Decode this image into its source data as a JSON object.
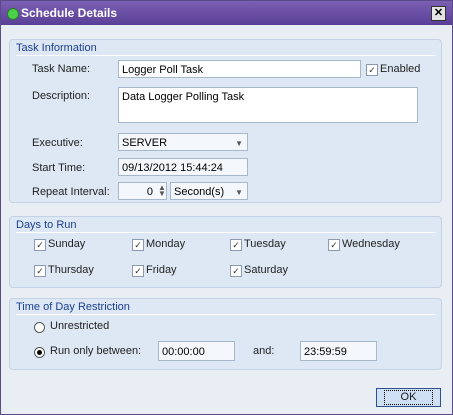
{
  "window": {
    "title": "Schedule Details",
    "close_label": "✕"
  },
  "task_info": {
    "title": "Task Information",
    "task_name_label": "Task Name:",
    "task_name_value": "Logger Poll Task",
    "enabled_label": "Enabled",
    "description_label": "Description:",
    "description_value": "Data Logger Polling Task",
    "executive_label": "Executive:",
    "executive_value": "SERVER",
    "start_time_label": "Start Time:",
    "start_time_value": "09/13/2012  15:44:24",
    "repeat_label": "Repeat Interval:",
    "repeat_value": "0",
    "repeat_unit": "Second(s)"
  },
  "days": {
    "title": "Days to Run",
    "items": [
      "Sunday",
      "Monday",
      "Tuesday",
      "Wednesday",
      "Thursday",
      "Friday",
      "Saturday"
    ]
  },
  "time_restriction": {
    "title": "Time of Day Restriction",
    "unrestricted_label": "Unrestricted",
    "run_between_label": "Run only between:",
    "start_value": "00:00:00",
    "and_label": "and:",
    "end_value": "23:59:59"
  },
  "buttons": {
    "ok_label": "OK"
  },
  "icons": {
    "check": "✓"
  }
}
